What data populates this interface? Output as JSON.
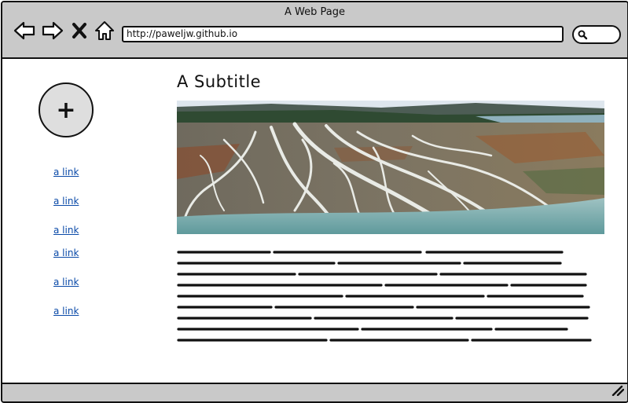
{
  "window": {
    "title": "A Web Page"
  },
  "toolbar": {
    "icons": [
      "back-arrow-icon",
      "forward-arrow-icon",
      "close-x-icon",
      "home-icon"
    ],
    "url": "http://paweljw.github.io",
    "search_icon": "search-icon"
  },
  "sidebar": {
    "add_icon": "plus-icon",
    "add_symbol": "+",
    "links": [
      {
        "label": "a link"
      },
      {
        "label": "a link"
      },
      {
        "label": "a link"
      },
      {
        "label": "a link"
      },
      {
        "label": "a link"
      },
      {
        "label": "a link"
      }
    ]
  },
  "main": {
    "subtitle": "A Subtitle",
    "hero_image": "braided river delta aerial photo"
  },
  "colors": {
    "chrome": "#c9c9c9",
    "link": "#0a4aa8",
    "border": "#111111"
  }
}
